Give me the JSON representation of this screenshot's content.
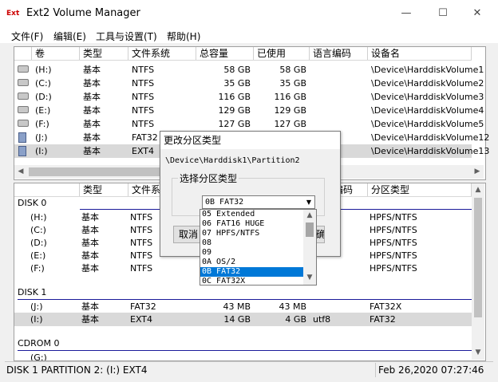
{
  "window": {
    "app_icon_text": "Ext",
    "title": "Ext2 Volume Manager",
    "minimize": "—",
    "maximize": "☐",
    "close": "✕"
  },
  "menu": [
    "文件(F)",
    "编辑(E)",
    "工具与设置(T)",
    "帮助(H)"
  ],
  "volumes": {
    "columns": [
      "卷",
      "类型",
      "文件系统",
      "总容量",
      "已使用",
      "语言编码",
      "设备名"
    ],
    "rows": [
      {
        "icon": "drive",
        "vol": "(H:)",
        "type": "基本",
        "fs": "NTFS",
        "total": "58 GB",
        "used": "58 GB",
        "enc": "",
        "dev": "\\Device\\HarddiskVolume1"
      },
      {
        "icon": "drive",
        "vol": "(C:)",
        "type": "基本",
        "fs": "NTFS",
        "total": "35 GB",
        "used": "35 GB",
        "enc": "",
        "dev": "\\Device\\HarddiskVolume2"
      },
      {
        "icon": "drive",
        "vol": "(D:)",
        "type": "基本",
        "fs": "NTFS",
        "total": "116 GB",
        "used": "116 GB",
        "enc": "",
        "dev": "\\Device\\HarddiskVolume3"
      },
      {
        "icon": "drive",
        "vol": "(E:)",
        "type": "基本",
        "fs": "NTFS",
        "total": "129 GB",
        "used": "129 GB",
        "enc": "",
        "dev": "\\Device\\HarddiskVolume4"
      },
      {
        "icon": "drive",
        "vol": "(F:)",
        "type": "基本",
        "fs": "NTFS",
        "total": "127 GB",
        "used": "127 GB",
        "enc": "",
        "dev": "\\Device\\HarddiskVolume5"
      },
      {
        "icon": "usb",
        "vol": "(J:)",
        "type": "基本",
        "fs": "FAT32",
        "total": "",
        "used": "",
        "enc": "",
        "dev": "\\Device\\HarddiskVolume12"
      },
      {
        "icon": "usb",
        "vol": "(I:)",
        "type": "基本",
        "fs": "EXT4",
        "total": "",
        "used": "",
        "enc": "",
        "dev": "\\Device\\HarddiskVolume13"
      }
    ]
  },
  "disks": {
    "columns": [
      "",
      "类型",
      "文件系统",
      "",
      "",
      "编码",
      "分区类型"
    ],
    "groups": [
      {
        "label": "DISK 0",
        "rows": [
          {
            "vol": "(H:)",
            "type": "基本",
            "fs": "NTFS",
            "size": "",
            "used": "",
            "enc": "",
            "ptype": "HPFS/NTFS"
          },
          {
            "vol": "(C:)",
            "type": "基本",
            "fs": "NTFS",
            "size": "",
            "used": "",
            "enc": "",
            "ptype": "HPFS/NTFS"
          },
          {
            "vol": "(D:)",
            "type": "基本",
            "fs": "NTFS",
            "size": "",
            "used": "",
            "enc": "",
            "ptype": "HPFS/NTFS"
          },
          {
            "vol": "(E:)",
            "type": "基本",
            "fs": "NTFS",
            "size": "",
            "used": "",
            "enc": "",
            "ptype": "HPFS/NTFS"
          },
          {
            "vol": "(F:)",
            "type": "基本",
            "fs": "NTFS",
            "size": "",
            "used": "",
            "enc": "",
            "ptype": "HPFS/NTFS"
          }
        ]
      },
      {
        "label": "DISK 1",
        "rows": [
          {
            "vol": "(J:)",
            "type": "基本",
            "fs": "FAT32",
            "size": "43 MB",
            "used": "43 MB",
            "enc": "",
            "ptype": "FAT32X"
          },
          {
            "vol": "(I:)",
            "type": "基本",
            "fs": "EXT4",
            "size": "14 GB",
            "used": "4 GB",
            "enc": "utf8",
            "ptype": "FAT32"
          }
        ]
      },
      {
        "label": "CDROM 0",
        "rows": [
          {
            "vol": "(G:)",
            "type": "",
            "fs": "",
            "size": "",
            "used": "",
            "enc": "",
            "ptype": ""
          }
        ]
      }
    ]
  },
  "status": {
    "left": "DISK 1 PARTITION 2: (I:) EXT4",
    "right": "Feb 26,2020 07:27:46"
  },
  "dialog": {
    "title": "更改分区类型",
    "path": "\\Device\\Harddisk1\\Partition2",
    "group_label": "选择分区类型",
    "combo_value": "0B FAT32",
    "cancel_label": "取消",
    "ok_label": "确",
    "options": [
      "05 Extended",
      "06 FAT16 HUGE",
      "07 HPFS/NTFS",
      "08",
      "09",
      "0A OS/2",
      "0B FAT32",
      "0C FAT32X"
    ],
    "selected_index": 6
  },
  "glyphs": {
    "left": "◀",
    "right": "▶",
    "up": "▲",
    "down": "▼",
    "combo_arrow": "▼"
  }
}
